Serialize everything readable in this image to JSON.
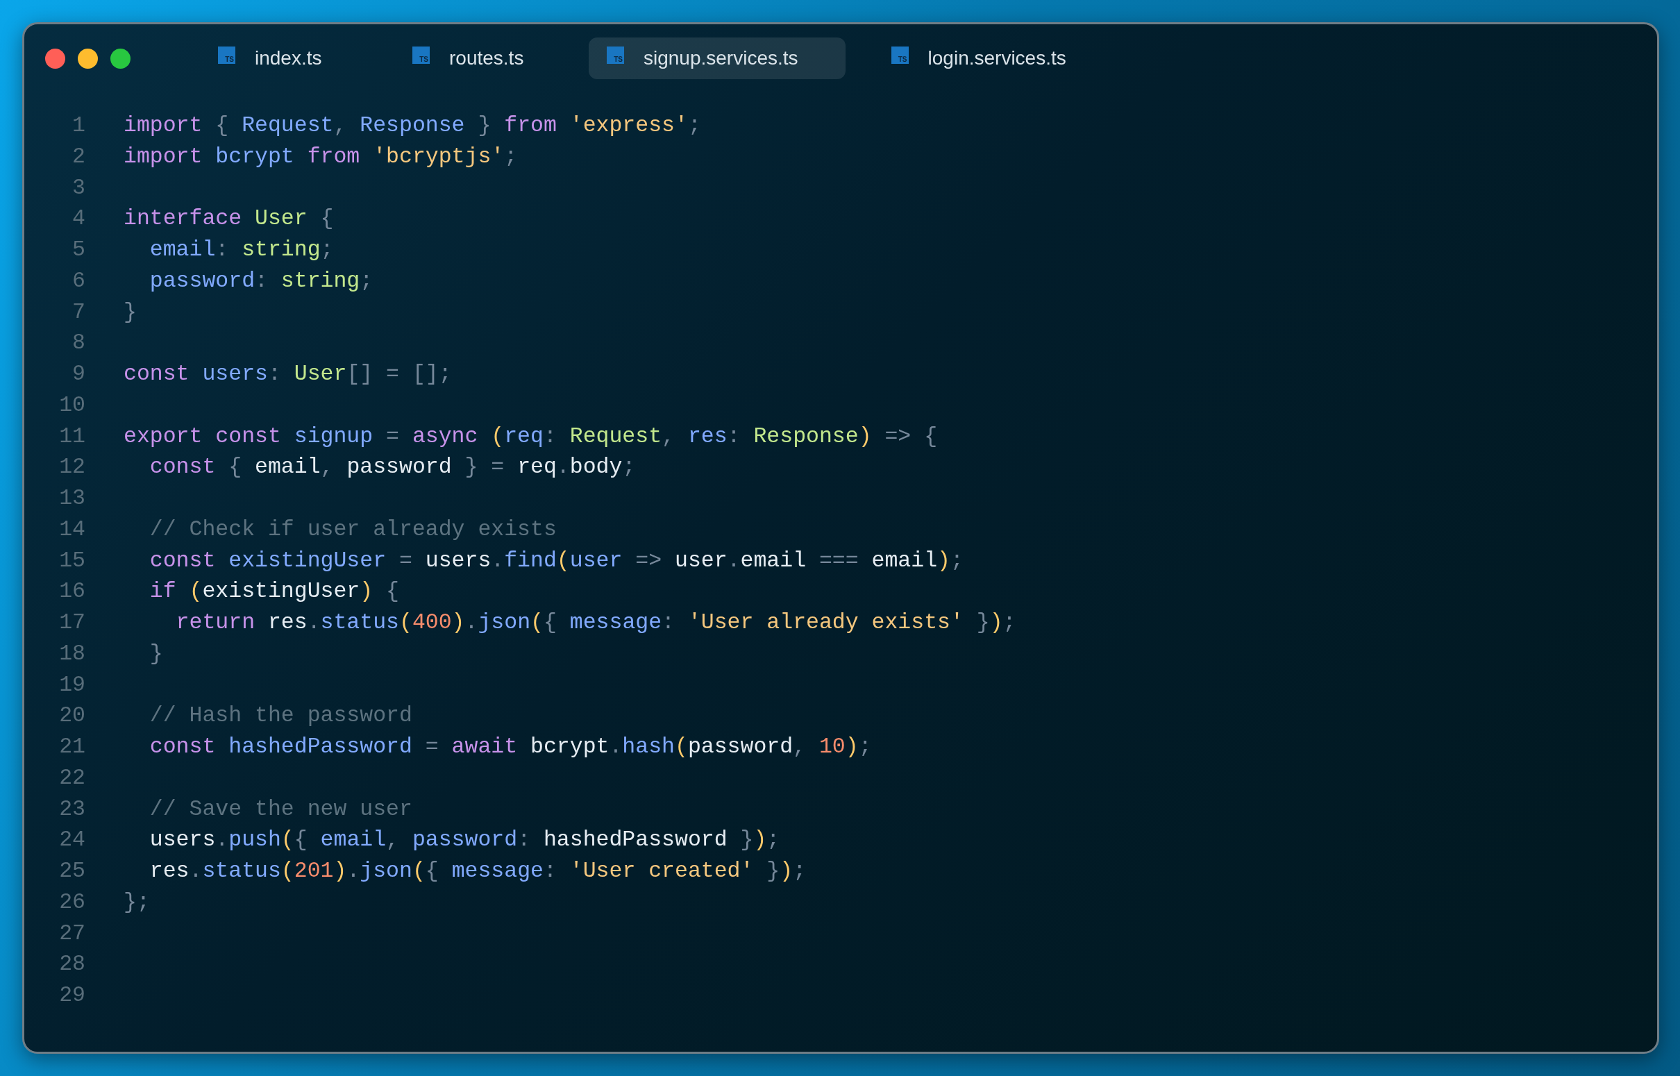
{
  "window": {
    "controls": [
      {
        "kind": "close"
      },
      {
        "kind": "minimize"
      },
      {
        "kind": "zoom"
      }
    ]
  },
  "tabs": [
    {
      "badge": "TS",
      "label": "index.ts",
      "selected": false
    },
    {
      "badge": "TS",
      "label": "routes.ts",
      "selected": false
    },
    {
      "badge": "TS",
      "label": "signup.services.ts",
      "selected": true
    },
    {
      "badge": "TS",
      "label": "login.services.ts",
      "selected": false
    }
  ],
  "editor": {
    "lines": [
      {
        "number": "1",
        "tokens": [
          {
            "kind": "keyword",
            "text": "import"
          },
          {
            "kind": "punct",
            "text": " { "
          },
          {
            "kind": "ident",
            "text": "Request"
          },
          {
            "kind": "punct",
            "text": ", "
          },
          {
            "kind": "ident",
            "text": "Response"
          },
          {
            "kind": "punct",
            "text": " } "
          },
          {
            "kind": "keyword",
            "text": "from "
          },
          {
            "kind": "string",
            "text": "'express'"
          },
          {
            "kind": "punct",
            "text": ";"
          }
        ]
      },
      {
        "number": "2",
        "tokens": [
          {
            "kind": "keyword",
            "text": "import "
          },
          {
            "kind": "ident",
            "text": "bcrypt "
          },
          {
            "kind": "keyword",
            "text": "from "
          },
          {
            "kind": "string",
            "text": "'bcryptjs'"
          },
          {
            "kind": "punct",
            "text": ";"
          }
        ]
      },
      {
        "number": "3"
      },
      {
        "number": "4",
        "tokens": [
          {
            "kind": "keyword",
            "text": "interface "
          },
          {
            "kind": "type",
            "text": "User "
          },
          {
            "kind": "punct",
            "text": "{"
          }
        ]
      },
      {
        "number": "5",
        "tokens": [
          {
            "kind": "ident",
            "text": "  email"
          },
          {
            "kind": "punct",
            "text": ": "
          },
          {
            "kind": "type",
            "text": "string"
          },
          {
            "kind": "punct",
            "text": ";"
          }
        ]
      },
      {
        "number": "6",
        "tokens": [
          {
            "kind": "ident",
            "text": "  password"
          },
          {
            "kind": "punct",
            "text": ": "
          },
          {
            "kind": "type",
            "text": "string"
          },
          {
            "kind": "punct",
            "text": ";"
          }
        ]
      },
      {
        "number": "7",
        "tokens": [
          {
            "kind": "punct",
            "text": "}"
          }
        ]
      },
      {
        "number": "8"
      },
      {
        "number": "9",
        "tokens": [
          {
            "kind": "keyword",
            "text": "const "
          },
          {
            "kind": "ident",
            "text": "users"
          },
          {
            "kind": "punct",
            "text": ": "
          },
          {
            "kind": "type",
            "text": "User"
          },
          {
            "kind": "punct",
            "text": "[] = [];"
          }
        ]
      },
      {
        "number": "10"
      },
      {
        "number": "11",
        "tokens": [
          {
            "kind": "keyword",
            "text": "export const "
          },
          {
            "kind": "ident",
            "text": "signup "
          },
          {
            "kind": "punct",
            "text": "= "
          },
          {
            "kind": "keyword",
            "text": "async "
          },
          {
            "kind": "paren",
            "text": "("
          },
          {
            "kind": "ident",
            "text": "req"
          },
          {
            "kind": "punct",
            "text": ": "
          },
          {
            "kind": "type",
            "text": "Request"
          },
          {
            "kind": "punct",
            "text": ", "
          },
          {
            "kind": "ident",
            "text": "res"
          },
          {
            "kind": "punct",
            "text": ": "
          },
          {
            "kind": "type",
            "text": "Response"
          },
          {
            "kind": "paren",
            "text": ")"
          },
          {
            "kind": "punct",
            "text": " => {"
          }
        ]
      },
      {
        "number": "12",
        "tokens": [
          {
            "kind": "keyword",
            "text": "  const "
          },
          {
            "kind": "punct",
            "text": "{ "
          },
          {
            "kind": "plain",
            "text": "email"
          },
          {
            "kind": "punct",
            "text": ", "
          },
          {
            "kind": "plain",
            "text": "password "
          },
          {
            "kind": "punct",
            "text": "} = "
          },
          {
            "kind": "plain",
            "text": "req"
          },
          {
            "kind": "punct",
            "text": "."
          },
          {
            "kind": "plain",
            "text": "body"
          },
          {
            "kind": "punct",
            "text": ";"
          }
        ]
      },
      {
        "number": "13"
      },
      {
        "number": "14",
        "tokens": [
          {
            "kind": "comment",
            "text": "  // Check if user already exists"
          }
        ]
      },
      {
        "number": "15",
        "tokens": [
          {
            "kind": "keyword",
            "text": "  const "
          },
          {
            "kind": "ident",
            "text": "existingUser "
          },
          {
            "kind": "punct",
            "text": "= "
          },
          {
            "kind": "plain",
            "text": "users"
          },
          {
            "kind": "punct",
            "text": "."
          },
          {
            "kind": "ident",
            "text": "find"
          },
          {
            "kind": "paren",
            "text": "("
          },
          {
            "kind": "ident",
            "text": "user "
          },
          {
            "kind": "punct",
            "text": "=> "
          },
          {
            "kind": "plain",
            "text": "user"
          },
          {
            "kind": "punct",
            "text": "."
          },
          {
            "kind": "plain",
            "text": "email "
          },
          {
            "kind": "punct",
            "text": "=== "
          },
          {
            "kind": "plain",
            "text": "email"
          },
          {
            "kind": "paren",
            "text": ")"
          },
          {
            "kind": "punct",
            "text": ";"
          }
        ]
      },
      {
        "number": "16",
        "tokens": [
          {
            "kind": "keyword",
            "text": "  if "
          },
          {
            "kind": "paren",
            "text": "("
          },
          {
            "kind": "plain",
            "text": "existingUser"
          },
          {
            "kind": "paren",
            "text": ")"
          },
          {
            "kind": "punct",
            "text": " {"
          }
        ]
      },
      {
        "number": "17",
        "tokens": [
          {
            "kind": "keyword",
            "text": "    return "
          },
          {
            "kind": "plain",
            "text": "res"
          },
          {
            "kind": "punct",
            "text": "."
          },
          {
            "kind": "ident",
            "text": "status"
          },
          {
            "kind": "paren",
            "text": "("
          },
          {
            "kind": "number",
            "text": "400"
          },
          {
            "kind": "paren",
            "text": ")"
          },
          {
            "kind": "punct",
            "text": "."
          },
          {
            "kind": "ident",
            "text": "json"
          },
          {
            "kind": "paren",
            "text": "("
          },
          {
            "kind": "punct",
            "text": "{ "
          },
          {
            "kind": "ident",
            "text": "message"
          },
          {
            "kind": "punct",
            "text": ": "
          },
          {
            "kind": "string",
            "text": "'User already exists'"
          },
          {
            "kind": "punct",
            "text": " }"
          },
          {
            "kind": "paren",
            "text": ")"
          },
          {
            "kind": "punct",
            "text": ";"
          }
        ]
      },
      {
        "number": "18",
        "tokens": [
          {
            "kind": "punct",
            "text": "  }"
          }
        ]
      },
      {
        "number": "19"
      },
      {
        "number": "20",
        "tokens": [
          {
            "kind": "comment",
            "text": "  // Hash the password"
          }
        ]
      },
      {
        "number": "21",
        "tokens": [
          {
            "kind": "keyword",
            "text": "  const "
          },
          {
            "kind": "ident",
            "text": "hashedPassword "
          },
          {
            "kind": "punct",
            "text": "= "
          },
          {
            "kind": "keyword",
            "text": "await "
          },
          {
            "kind": "plain",
            "text": "bcrypt"
          },
          {
            "kind": "punct",
            "text": "."
          },
          {
            "kind": "ident",
            "text": "hash"
          },
          {
            "kind": "paren",
            "text": "("
          },
          {
            "kind": "plain",
            "text": "password"
          },
          {
            "kind": "punct",
            "text": ", "
          },
          {
            "kind": "number",
            "text": "10"
          },
          {
            "kind": "paren",
            "text": ")"
          },
          {
            "kind": "punct",
            "text": ";"
          }
        ]
      },
      {
        "number": "22"
      },
      {
        "number": "23",
        "tokens": [
          {
            "kind": "comment",
            "text": "  // Save the new user"
          }
        ]
      },
      {
        "number": "24",
        "tokens": [
          {
            "kind": "plain",
            "text": "  users"
          },
          {
            "kind": "punct",
            "text": "."
          },
          {
            "kind": "ident",
            "text": "push"
          },
          {
            "kind": "paren",
            "text": "("
          },
          {
            "kind": "punct",
            "text": "{ "
          },
          {
            "kind": "ident",
            "text": "email"
          },
          {
            "kind": "punct",
            "text": ", "
          },
          {
            "kind": "ident",
            "text": "password"
          },
          {
            "kind": "punct",
            "text": ": "
          },
          {
            "kind": "plain",
            "text": "hashedPassword "
          },
          {
            "kind": "punct",
            "text": "}"
          },
          {
            "kind": "paren",
            "text": ")"
          },
          {
            "kind": "punct",
            "text": ";"
          }
        ]
      },
      {
        "number": "25",
        "tokens": [
          {
            "kind": "plain",
            "text": "  res"
          },
          {
            "kind": "punct",
            "text": "."
          },
          {
            "kind": "ident",
            "text": "status"
          },
          {
            "kind": "paren",
            "text": "("
          },
          {
            "kind": "number",
            "text": "201"
          },
          {
            "kind": "paren",
            "text": ")"
          },
          {
            "kind": "punct",
            "text": "."
          },
          {
            "kind": "ident",
            "text": "json"
          },
          {
            "kind": "paren",
            "text": "("
          },
          {
            "kind": "punct",
            "text": "{ "
          },
          {
            "kind": "ident",
            "text": "message"
          },
          {
            "kind": "punct",
            "text": ": "
          },
          {
            "kind": "string",
            "text": "'User created'"
          },
          {
            "kind": "punct",
            "text": " }"
          },
          {
            "kind": "paren",
            "text": ")"
          },
          {
            "kind": "punct",
            "text": ";"
          }
        ]
      },
      {
        "number": "26",
        "tokens": [
          {
            "kind": "punct",
            "text": "};"
          }
        ]
      },
      {
        "number": "27"
      },
      {
        "number": "28"
      },
      {
        "number": "29"
      }
    ]
  }
}
